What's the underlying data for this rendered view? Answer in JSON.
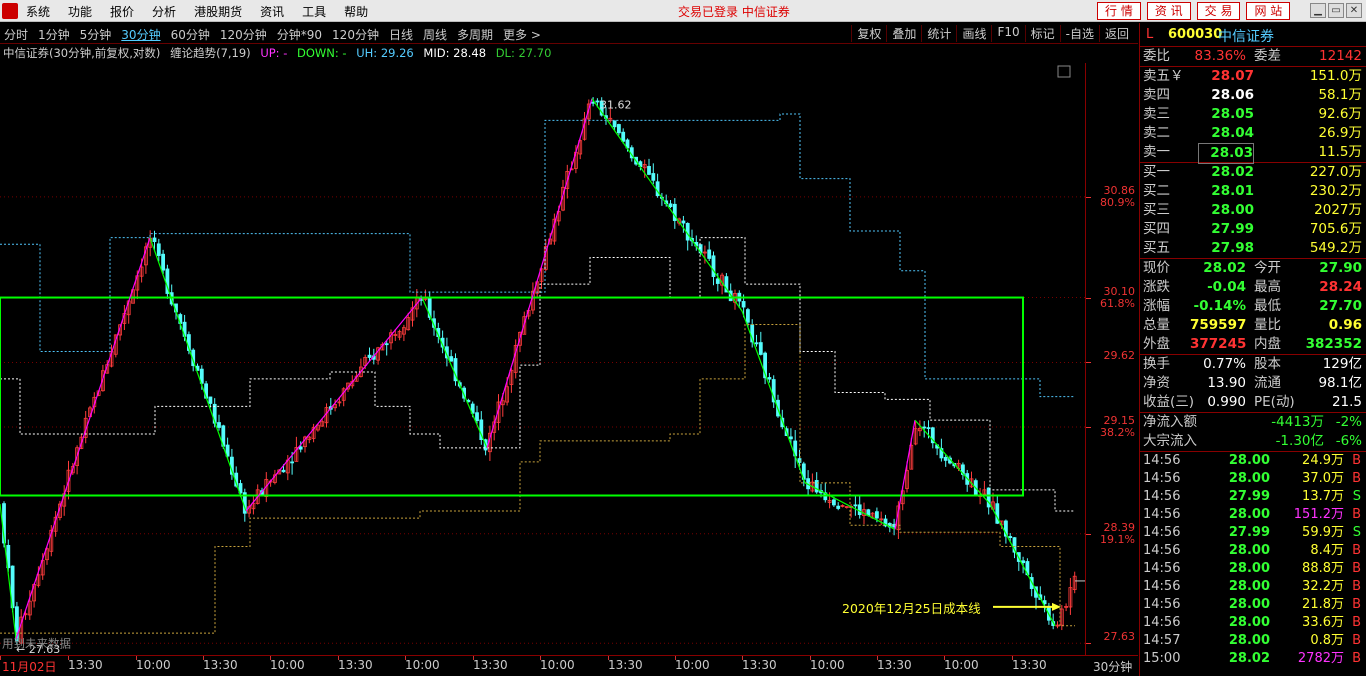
{
  "menubar": {
    "items": [
      "系统",
      "功能",
      "报价",
      "分析",
      "港股期货",
      "资讯",
      "工具",
      "帮助"
    ],
    "status": "交易已登录  中信证券",
    "buttons": [
      "行 情",
      "资 讯",
      "交 易",
      "网 站"
    ],
    "winctl": [
      "▁",
      "▭",
      "✕"
    ]
  },
  "toolbar": {
    "periods": [
      "分时",
      "1分钟",
      "5分钟",
      "30分钟",
      "60分钟",
      "120分钟",
      "分钟*90",
      "120分钟",
      "日线",
      "周线",
      "多周期",
      "更多 >"
    ],
    "active_period": "30分钟",
    "right_items": [
      "复权",
      "叠加",
      "统计",
      "画线",
      "F10",
      "标记",
      "-自选",
      "返回"
    ]
  },
  "infobar": {
    "stock": "中信证券(30分钟,前复权,对数)",
    "indicator": "缠论趋势(7,19)",
    "up": "UP: -",
    "down": "DOWN: -",
    "uh": "UH: 29.26",
    "mid": "MID: 28.48",
    "dl": "DL: 27.70"
  },
  "chart_data": {
    "type": "candlestick",
    "yaxis_labels": [
      {
        "price": "30.86",
        "pct": "80.9%"
      },
      {
        "price": "30.10",
        "pct": "61.8%"
      },
      {
        "price": "29.62",
        "pct": ""
      },
      {
        "price": "29.15",
        "pct": "38.2%"
      },
      {
        "price": "28.39",
        "pct": "19.1%"
      },
      {
        "price": "27.63",
        "pct": ""
      }
    ],
    "high_label": "31.62",
    "low_label": "← 27.63",
    "annotation": "2020年12月25日成本线",
    "watermark": "用到未来数据",
    "x_labels": [
      "11月02日",
      "13:30",
      "10:00",
      "13:30",
      "10:00",
      "13:30",
      "10:00",
      "13:30",
      "10:00",
      "13:30",
      "10:00",
      "13:30",
      "10:00",
      "13:30",
      "10:00",
      "13:30"
    ],
    "period_label": "30分钟",
    "up_color": "#ff3c3c",
    "down_color": "#54fcfc",
    "zigzag_up_color": "#ff00ff",
    "zigzag_down_color": "#00ff00",
    "box_color": "#00ff00"
  },
  "panel": {
    "badge": "L",
    "code": "600030",
    "name": "中信证券",
    "weibi_label": "委比",
    "weibi": "83.36%",
    "weicha_label": "委差",
    "weicha": "12142",
    "asks": [
      {
        "label": "卖五￥",
        "price": "28.07",
        "vol": "151.0万",
        "pc": "red"
      },
      {
        "label": "卖四",
        "price": "28.06",
        "vol": "58.1万",
        "pc": "white"
      },
      {
        "label": "卖三",
        "price": "28.05",
        "vol": "92.6万",
        "pc": "green"
      },
      {
        "label": "卖二",
        "price": "28.04",
        "vol": "26.9万",
        "pc": "green"
      },
      {
        "label": "卖一",
        "price": "28.03",
        "vol": "11.5万",
        "pc": "green"
      }
    ],
    "bids": [
      {
        "label": "买一",
        "price": "28.02",
        "vol": "227.0万",
        "pc": "green"
      },
      {
        "label": "买二",
        "price": "28.01",
        "vol": "230.2万",
        "pc": "green"
      },
      {
        "label": "买三",
        "price": "28.00",
        "vol": "2027万",
        "pc": "green"
      },
      {
        "label": "买四",
        "price": "27.99",
        "vol": "705.6万",
        "pc": "green"
      },
      {
        "label": "买五",
        "price": "27.98",
        "vol": "549.2万",
        "pc": "green"
      }
    ],
    "stats": [
      {
        "l1": "现价",
        "v1": "28.02",
        "c1": "green",
        "l2": "今开",
        "v2": "27.90",
        "c2": "green"
      },
      {
        "l1": "涨跌",
        "v1": "-0.04",
        "c1": "green",
        "l2": "最高",
        "v2": "28.24",
        "c2": "red"
      },
      {
        "l1": "涨幅",
        "v1": "-0.14%",
        "c1": "green",
        "l2": "最低",
        "v2": "27.70",
        "c2": "green"
      },
      {
        "l1": "总量",
        "v1": "759597",
        "c1": "yellow",
        "l2": "量比",
        "v2": "0.96",
        "c2": "yellow"
      },
      {
        "l1": "外盘",
        "v1": "377245",
        "c1": "red",
        "l2": "内盘",
        "v2": "382352",
        "c2": "green"
      }
    ],
    "fin": [
      {
        "l1": "换手",
        "v1": "0.77%",
        "l2": "股本",
        "v2": "129亿"
      },
      {
        "l1": "净资",
        "v1": "13.90",
        "l2": "流通",
        "v2": "98.1亿"
      },
      {
        "l1": "收益(三)",
        "v1": "0.990",
        "l2": "PE(动)",
        "v2": "21.5"
      }
    ],
    "flow": [
      {
        "label": "净流入额",
        "value": "-4413万",
        "pct": "-2%"
      },
      {
        "label": "大宗流入",
        "value": "-1.30亿",
        "pct": "-6%"
      }
    ],
    "ticks": [
      {
        "t": "14:56",
        "p": "28.00",
        "v": "24.9万",
        "d": "B",
        "vc": "yellow"
      },
      {
        "t": "14:56",
        "p": "28.00",
        "v": "37.0万",
        "d": "B",
        "vc": "yellow"
      },
      {
        "t": "14:56",
        "p": "27.99",
        "v": "13.7万",
        "d": "S",
        "vc": "yellow"
      },
      {
        "t": "14:56",
        "p": "28.00",
        "v": "151.2万",
        "d": "B",
        "vc": "mag"
      },
      {
        "t": "14:56",
        "p": "27.99",
        "v": "59.9万",
        "d": "S",
        "vc": "yellow"
      },
      {
        "t": "14:56",
        "p": "28.00",
        "v": "8.4万",
        "d": "B",
        "vc": "yellow"
      },
      {
        "t": "14:56",
        "p": "28.00",
        "v": "88.8万",
        "d": "B",
        "vc": "yellow"
      },
      {
        "t": "14:56",
        "p": "28.00",
        "v": "32.2万",
        "d": "B",
        "vc": "yellow"
      },
      {
        "t": "14:56",
        "p": "28.00",
        "v": "21.8万",
        "d": "B",
        "vc": "yellow"
      },
      {
        "t": "14:56",
        "p": "28.00",
        "v": "33.6万",
        "d": "B",
        "vc": "yellow"
      },
      {
        "t": "14:57",
        "p": "28.00",
        "v": "0.8万",
        "d": "B",
        "vc": "yellow"
      },
      {
        "t": "15:00",
        "p": "28.02",
        "v": "2782万",
        "d": "B",
        "vc": "mag"
      }
    ]
  }
}
